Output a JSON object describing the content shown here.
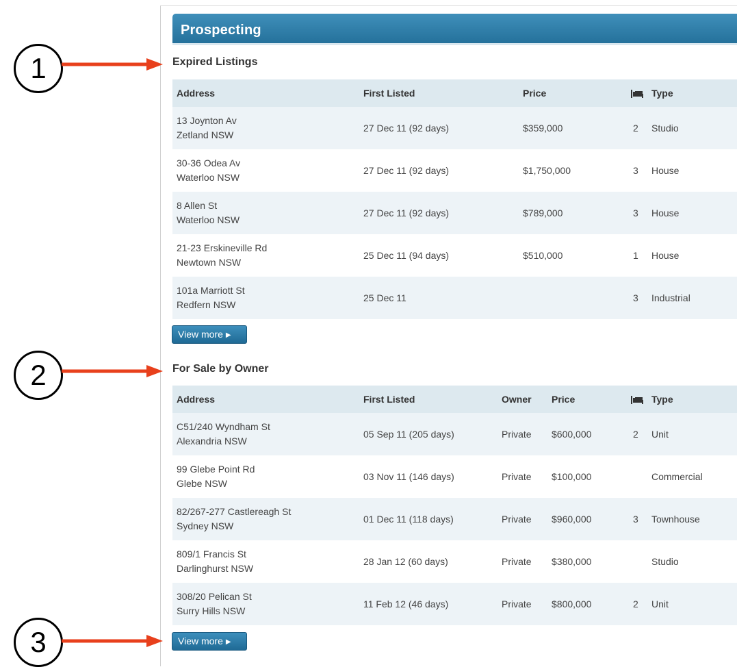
{
  "panel": {
    "title": "Prospecting"
  },
  "expired": {
    "title": "Expired Listings",
    "headers": {
      "address": "Address",
      "first_listed": "First Listed",
      "price": "Price",
      "type": "Type"
    },
    "rows": [
      {
        "street": "13 Joynton Av",
        "suburb": "Zetland NSW",
        "first_listed": "27 Dec 11 (92 days)",
        "price": "$359,000",
        "beds": "2",
        "type": "Studio"
      },
      {
        "street": "30-36 Odea Av",
        "suburb": "Waterloo NSW",
        "first_listed": "27 Dec 11 (92 days)",
        "price": "$1,750,000",
        "beds": "3",
        "type": "House"
      },
      {
        "street": "8 Allen St",
        "suburb": "Waterloo NSW",
        "first_listed": "27 Dec 11 (92 days)",
        "price": "$789,000",
        "beds": "3",
        "type": "House"
      },
      {
        "street": "21-23 Erskineville Rd",
        "suburb": "Newtown NSW",
        "first_listed": "25 Dec 11 (94 days)",
        "price": "$510,000",
        "beds": "1",
        "type": "House"
      },
      {
        "street": "101a Marriott St",
        "suburb": "Redfern NSW",
        "first_listed": "25 Dec 11",
        "price": "",
        "beds": "3",
        "type": "Industrial"
      }
    ],
    "view_more": "View more"
  },
  "fsbo": {
    "title": "For Sale by Owner",
    "headers": {
      "address": "Address",
      "first_listed": "First Listed",
      "owner": "Owner",
      "price": "Price",
      "type": "Type"
    },
    "rows": [
      {
        "street": "C51/240 Wyndham St",
        "suburb": "Alexandria NSW",
        "first_listed": "05 Sep 11 (205 days)",
        "owner": "Private",
        "price": "$600,000",
        "beds": "2",
        "type": "Unit"
      },
      {
        "street": "99 Glebe Point Rd",
        "suburb": "Glebe NSW",
        "first_listed": "03 Nov 11 (146 days)",
        "owner": "Private",
        "price": "$100,000",
        "beds": "",
        "type": "Commercial"
      },
      {
        "street": "82/267-277 Castlereagh St",
        "suburb": "Sydney NSW",
        "first_listed": "01 Dec 11 (118 days)",
        "owner": "Private",
        "price": "$960,000",
        "beds": "3",
        "type": "Townhouse"
      },
      {
        "street": "809/1 Francis St",
        "suburb": "Darlinghurst NSW",
        "first_listed": "28 Jan 12 (60 days)",
        "owner": "Private",
        "price": "$380,000",
        "beds": "",
        "type": "Studio"
      },
      {
        "street": "308/20 Pelican St",
        "suburb": "Surry Hills NSW",
        "first_listed": "11 Feb 12 (46 days)",
        "owner": "Private",
        "price": "$800,000",
        "beds": "2",
        "type": "Unit"
      }
    ],
    "view_more": "View more"
  },
  "icons": {
    "beds": "bed-icon",
    "view_more": "triangle-right-icon"
  },
  "callouts": [
    "1",
    "2",
    "3"
  ],
  "colors": {
    "header": "#2a7aa5",
    "arrow": "#e8401c",
    "link": "#2a6f9e",
    "row_alt": "#edf3f7",
    "table_header": "#dde9ef"
  }
}
